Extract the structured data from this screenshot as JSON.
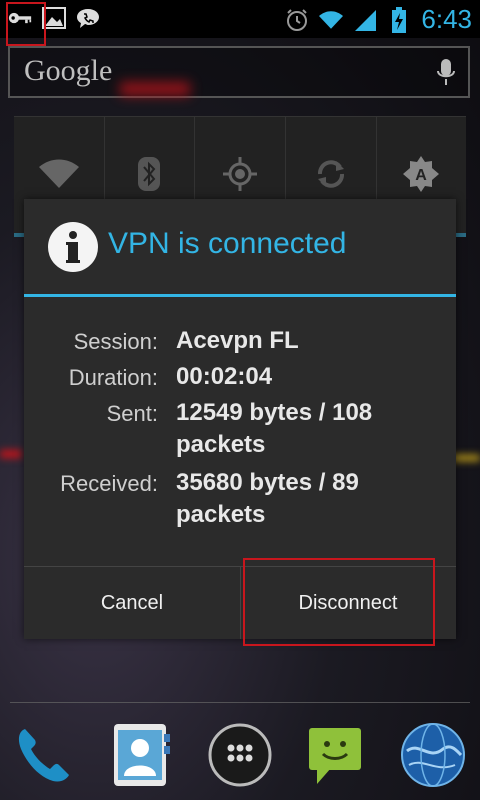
{
  "status_bar": {
    "time": "6:43",
    "left_icons": [
      "vpn-key-icon",
      "gallery-icon",
      "voicemail-icon"
    ],
    "right_icons": [
      "alarm-icon",
      "wifi-icon",
      "cell-signal-icon",
      "battery-charging-icon"
    ]
  },
  "search": {
    "logo": "Google",
    "mic_icon": "microphone-icon"
  },
  "widget": {
    "toggles": [
      "wifi-icon",
      "bluetooth-icon",
      "gps-icon",
      "sync-icon",
      "brightness-auto-icon"
    ]
  },
  "dialog": {
    "title": "VPN is connected",
    "icon": "info-icon",
    "rows": [
      {
        "label": "Session:",
        "value": "Acevpn FL"
      },
      {
        "label": "Duration:",
        "value": "00:02:04"
      },
      {
        "label": "Sent:",
        "value": "12549 bytes / 108 packets"
      },
      {
        "label": "Received:",
        "value": "35680 bytes / 89 packets"
      }
    ],
    "cancel_label": "Cancel",
    "disconnect_label": "Disconnect"
  },
  "dock": {
    "items": [
      "phone-icon",
      "contacts-icon",
      "app-drawer-icon",
      "messaging-icon",
      "browser-icon"
    ]
  },
  "colors": {
    "accent": "#33b5e5",
    "highlight": "#c8161d"
  }
}
